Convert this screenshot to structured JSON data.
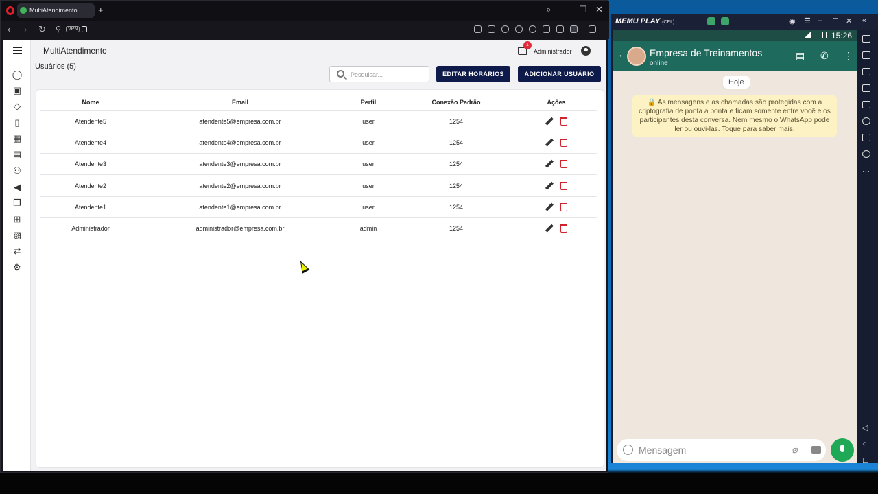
{
  "browser": {
    "tab_title": "MultiAtendimento",
    "vpn_label": "VPN",
    "accent": "#e2202a"
  },
  "app": {
    "title": "MultiAtendimento",
    "notification_count": "1",
    "user_name": "Administrador",
    "page_heading": "Usuários (5)",
    "search_placeholder": "Pesquisar...",
    "btn_edit_hours": "EDITAR HORÁRIOS",
    "btn_add_user": "ADICIONAR USUÁRIO",
    "sidebar_icons": [
      "whatsapp-icon",
      "contacts-icon",
      "tag-icon",
      "bookmark-icon",
      "calendar-icon",
      "chat-icon",
      "users-icon",
      "megaphone-icon",
      "queue-icon",
      "flow-icon",
      "dashboard-icon",
      "transfer-icon",
      "settings-icon"
    ],
    "columns": [
      "Nome",
      "Email",
      "Perfil",
      "Conexão Padrão",
      "Ações"
    ],
    "rows": [
      {
        "name": "Atendente5",
        "email": "atendente5@empresa.com.br",
        "profile": "user",
        "connection": "1254"
      },
      {
        "name": "Atendente4",
        "email": "atendente4@empresa.com.br",
        "profile": "user",
        "connection": "1254"
      },
      {
        "name": "Atendente3",
        "email": "atendente3@empresa.com.br",
        "profile": "user",
        "connection": "1254"
      },
      {
        "name": "Atendente2",
        "email": "atendente2@empresa.com.br",
        "profile": "user",
        "connection": "1254"
      },
      {
        "name": "Atendente1",
        "email": "atendente1@empresa.com.br",
        "profile": "user",
        "connection": "1254"
      },
      {
        "name": "Administrador",
        "email": "administrador@empresa.com.br",
        "profile": "admin",
        "connection": "1254"
      }
    ],
    "primary_color": "#0e1a4a",
    "delete_color": "#d2222d"
  },
  "emulator": {
    "brand": "MEMU PLAY",
    "brand_suffix": "(CEL)",
    "time": "15:26",
    "chat_name": "Empresa de Treinamentos",
    "chat_status": "online",
    "date_chip": "Hoje",
    "encryption_note": "🔒 As mensagens e as chamadas são protegidas com a criptografia de ponta a ponta e ficam somente entre você e os participantes desta conversa. Nem mesmo o WhatsApp pode ler ou ouvi-las. Toque para saber mais.",
    "message_placeholder": "Mensagem",
    "header_color": "#1e6a5c",
    "mic_color": "#1fa855"
  }
}
